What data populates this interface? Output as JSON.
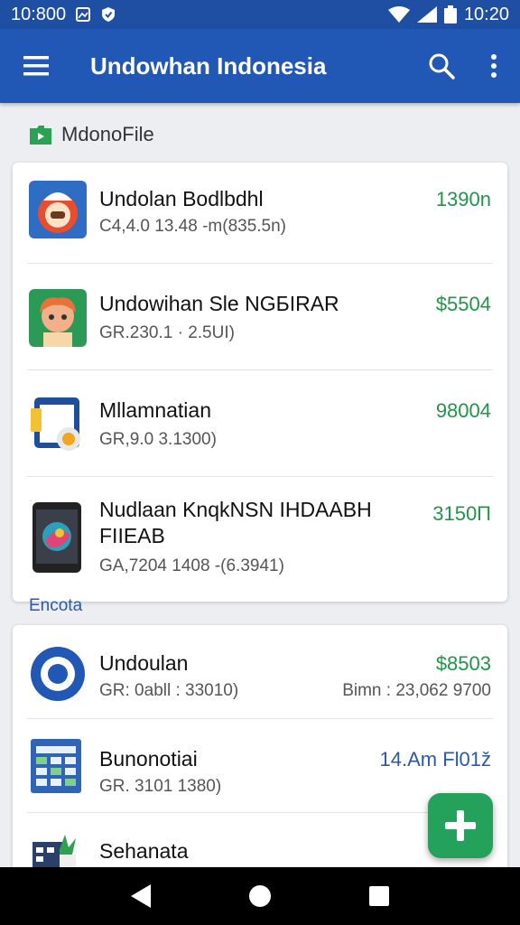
{
  "status_bar": {
    "time_left": "10:800",
    "time_right": "10:20"
  },
  "app_bar": {
    "title": "Undowhan Indonesia"
  },
  "section1": {
    "title": "MdonoFile"
  },
  "section2": {
    "title": "Encota"
  },
  "card1": {
    "items": [
      {
        "title": "Undolan Bodlbdhl",
        "subtitle": "C4,4.0 13.48 -m(835.5n)",
        "value": "1390n",
        "icon": "chef-app-icon"
      },
      {
        "title": "Undowihan Sle NGБIRAR",
        "subtitle": "GR.230.1 · 2.5UI)",
        "value": "$5504",
        "icon": "cartoon-character-icon"
      },
      {
        "title": "Mllamnatian",
        "subtitle": "GR,9.0 3.1300)",
        "value": "98004",
        "icon": "document-app-icon"
      },
      {
        "title": "Nudlaan KnqkNSN IHDAABH FIIEAB",
        "subtitle": "GA,7204 1408 -(6.3941)",
        "value": "3150П",
        "icon": "phone-app-icon"
      }
    ]
  },
  "card2": {
    "items": [
      {
        "title": "Undoulan",
        "subtitle": "GR: 0abll : 33010)",
        "value": "$8503",
        "meta": "Bimn : 23,062 9700",
        "icon": "circle-app-icon"
      },
      {
        "title": "Bunonotiai",
        "subtitle": "GR. 3101 1380)",
        "value": "14.Am Fl01ž",
        "icon": "spreadsheet-app-icon"
      },
      {
        "title": "Sehanata",
        "subtitle": "",
        "value": "",
        "icon": "plant-app-icon"
      }
    ]
  },
  "colors": {
    "primary": "#2157b5",
    "status": "#1f4fa3",
    "accent_green": "#24a15a",
    "value_green": "#21944a"
  }
}
